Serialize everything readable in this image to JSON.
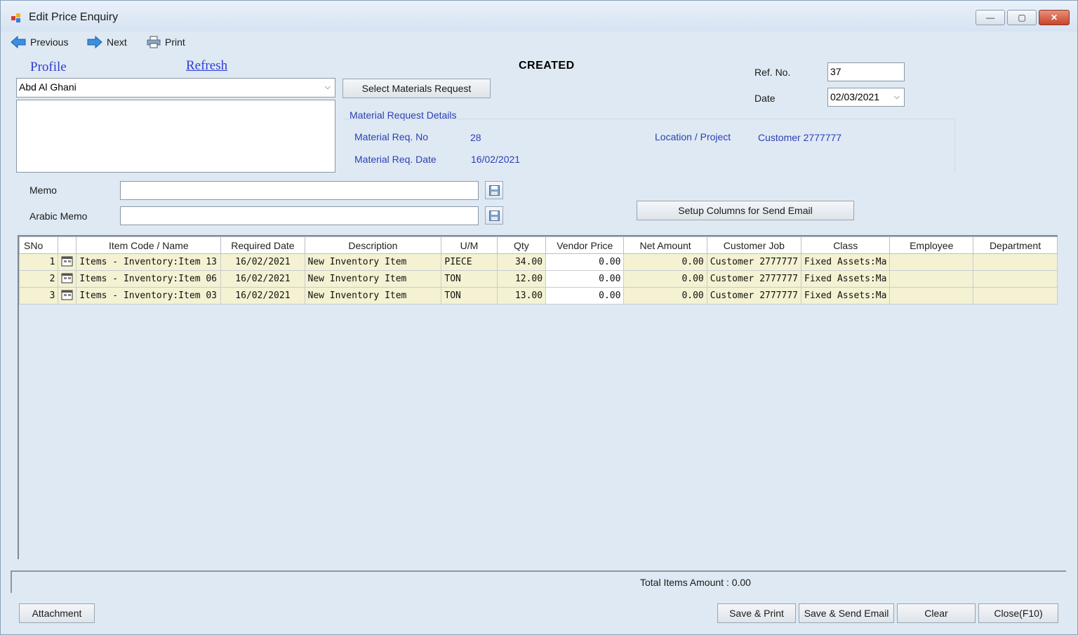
{
  "window": {
    "title": "Edit Price Enquiry",
    "controls": {
      "minimize": "—",
      "maximize": "▢",
      "close": "✕"
    }
  },
  "toolbar": {
    "previous": "Previous",
    "next": "Next",
    "print": "Print"
  },
  "links": {
    "profile": "Profile",
    "refresh": "Refresh"
  },
  "customer": {
    "selected": "Abd Al Ghani"
  },
  "status": "CREATED",
  "ref": {
    "label": "Ref. No.",
    "value": "37"
  },
  "date": {
    "label": "Date",
    "value": "02/03/2021"
  },
  "buttons": {
    "select_request": "Select Materials Request",
    "setup_columns": "Setup Columns for Send Email",
    "attachment": "Attachment",
    "save_print": "Save & Print",
    "save_email": "Save & Send Email",
    "clear": "Clear",
    "close": "Close(F10)"
  },
  "request_details": {
    "heading": "Material Request Details",
    "no_label": "Material Req. No",
    "no_value": "28",
    "date_label": "Material Req. Date",
    "date_value": "16/02/2021",
    "location_label": "Location / Project",
    "location_value": "Customer 2777777"
  },
  "memo": {
    "label": "Memo",
    "value": "",
    "arabic_label": "Arabic Memo",
    "arabic_value": ""
  },
  "table": {
    "columns": [
      "SNo",
      "",
      "Item Code / Name",
      "Required Date",
      "Description",
      "U/M",
      "Qty",
      "Vendor Price",
      "Net Amount",
      "Customer Job",
      "Class",
      "Employee",
      "Department"
    ],
    "rows": [
      {
        "sno": "1",
        "item": "Items - Inventory:Item 13",
        "required_date": "16/02/2021",
        "description": "New Inventory Item",
        "um": "PIECE",
        "qty": "34.00",
        "vendor_price": "0.00",
        "net_amount": "0.00",
        "customer_job": "Customer 2777777",
        "class": "Fixed Assets:Ma",
        "employee": "",
        "department": ""
      },
      {
        "sno": "2",
        "item": "Items - Inventory:Item 06",
        "required_date": "16/02/2021",
        "description": "New Inventory Item",
        "um": "TON",
        "qty": "12.00",
        "vendor_price": "0.00",
        "net_amount": "0.00",
        "customer_job": "Customer 2777777",
        "class": "Fixed Assets:Ma",
        "employee": "",
        "department": ""
      },
      {
        "sno": "3",
        "item": "Items - Inventory:Item 03",
        "required_date": "16/02/2021",
        "description": "New Inventory Item",
        "um": "TON",
        "qty": "13.00",
        "vendor_price": "0.00",
        "net_amount": "0.00",
        "customer_job": "Customer 2777777",
        "class": "Fixed Assets:Ma",
        "employee": "",
        "department": ""
      }
    ]
  },
  "total": "Total Items Amount : 0.00"
}
